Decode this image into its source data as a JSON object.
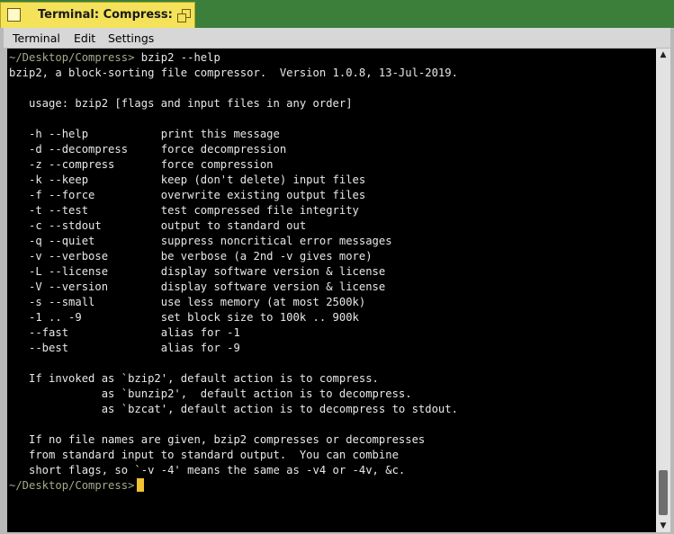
{
  "window": {
    "title": "Terminal: Compress: --"
  },
  "menu": [
    "Terminal",
    "Edit",
    "Settings"
  ],
  "terminal": {
    "prompt_path": "~/Desktop/Compress>",
    "command": " bzip2 --help",
    "output": "bzip2, a block-sorting file compressor.  Version 1.0.8, 13-Jul-2019.\n\n   usage: bzip2 [flags and input files in any order]\n\n   -h --help           print this message\n   -d --decompress     force decompression\n   -z --compress       force compression\n   -k --keep           keep (don't delete) input files\n   -f --force          overwrite existing output files\n   -t --test           test compressed file integrity\n   -c --stdout         output to standard out\n   -q --quiet          suppress noncritical error messages\n   -v --verbose        be verbose (a 2nd -v gives more)\n   -L --license        display software version & license\n   -V --version        display software version & license\n   -s --small          use less memory (at most 2500k)\n   -1 .. -9            set block size to 100k .. 900k\n   --fast              alias for -1\n   --best              alias for -9\n\n   If invoked as `bzip2', default action is to compress.\n              as `bunzip2',  default action is to decompress.\n              as `bzcat', default action is to decompress to stdout.\n\n   If no file names are given, bzip2 compresses or decompresses\n   from standard input to standard output.  You can combine\n   short flags, so `-v -4' means the same as -v4 or -4v, &c.\n",
    "final_prompt_path": "~/Desktop/Compress>"
  },
  "scrollbar": {
    "up_glyph": "▲",
    "down_glyph": "▼"
  },
  "colors": {
    "desktop": "#3b7f3b",
    "title_tab": "#f3e25a",
    "terminal_bg": "#000000",
    "terminal_fg": "#e8e8e8",
    "prompt": "#a7a98a",
    "cursor": "#f1c232"
  }
}
